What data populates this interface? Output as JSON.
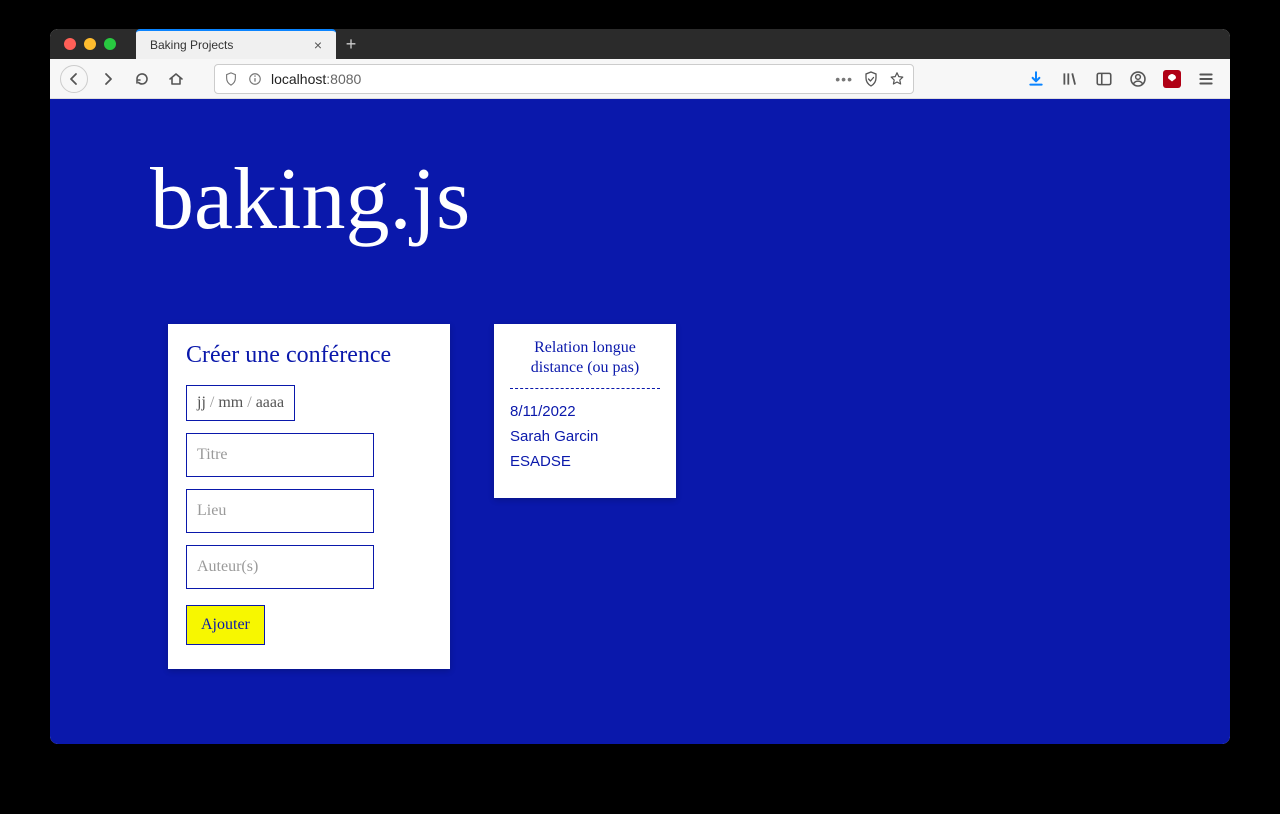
{
  "tab": {
    "title": "Baking Projects"
  },
  "url": {
    "host": "localhost",
    "port": ":8080"
  },
  "page": {
    "logo": "baking.js",
    "create": {
      "heading": "Créer une conférence",
      "date": {
        "day": "jj",
        "month": "mm",
        "year": "aaaa",
        "sep": "/"
      },
      "title_placeholder": "Titre",
      "place_placeholder": "Lieu",
      "author_placeholder": "Auteur(s)",
      "submit_label": "Ajouter"
    },
    "conference": {
      "title": "Relation longue distance (ou pas)",
      "date": "8/11/2022",
      "author": "Sarah Garcin",
      "place": "ESADSE"
    }
  }
}
